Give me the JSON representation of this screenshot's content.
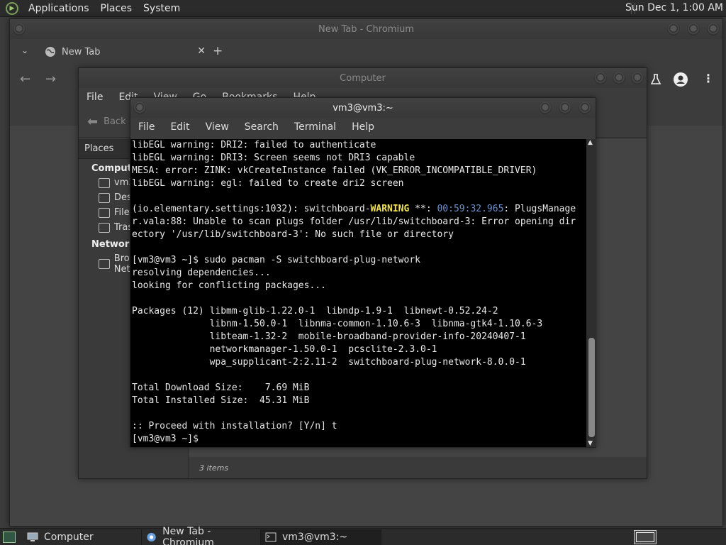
{
  "top_panel": {
    "menus": [
      "Applications",
      "Places",
      "System"
    ],
    "clock": "Sun Dec 1,  1:00 AM"
  },
  "chromium": {
    "title": "New Tab - Chromium",
    "tab_label": "New Tab"
  },
  "nautilus": {
    "title": "Computer",
    "menus": [
      "File",
      "Edit",
      "View",
      "Go",
      "Bookmarks",
      "Help"
    ],
    "toolbar_back": "Back",
    "sidebar": {
      "header": "Places",
      "sections": [
        {
          "title": "Computer",
          "items": [
            "vm3",
            "Desktop",
            "File System",
            "Trash"
          ]
        },
        {
          "title": "Network",
          "items": [
            "Browse Network"
          ]
        }
      ]
    },
    "status": "3 items"
  },
  "terminal": {
    "title": "vm3@vm3:~",
    "menus": [
      "File",
      "Edit",
      "View",
      "Search",
      "Terminal",
      "Help"
    ],
    "lines": [
      "libEGL warning: DRI2: failed to authenticate",
      "libEGL warning: DRI3: Screen seems not DRI3 capable",
      "MESA: error: ZINK: vkCreateInstance failed (VK_ERROR_INCOMPATIBLE_DRIVER)",
      "libEGL warning: egl: failed to create dri2 screen",
      "",
      "(io.elementary.settings:1032): switchboard-WARNING **: 00:59:32.965: PlugsManage",
      "r.vala:88: Unable to scan plugs folder /usr/lib/switchboard-3: Error opening dir",
      "ectory '/usr/lib/switchboard-3': No such file or directory",
      "",
      "[vm3@vm3 ~]$ sudo pacman -S switchboard-plug-network",
      "resolving dependencies...",
      "looking for conflicting packages...",
      "",
      "Packages (12) libmm-glib-1.22.0-1  libndp-1.9-1  libnewt-0.52.24-2",
      "              libnm-1.50.0-1  libnma-common-1.10.6-3  libnma-gtk4-1.10.6-3",
      "              libteam-1.32-2  mobile-broadband-provider-info-20240407-1",
      "              networkmanager-1.50.0-1  pcsclite-2.3.0-1",
      "              wpa_supplicant-2:2.11-2  switchboard-plug-network-8.0.0-1",
      "",
      "Total Download Size:    7.69 MiB",
      "Total Installed Size:  45.31 MiB",
      "",
      ":: Proceed with installation? [Y/n] t",
      "[vm3@vm3 ~]$"
    ],
    "warn_prefix": "(io.elementary.settings:1032): switchboard-",
    "warn_word": "WARNING",
    "warn_mid": " **: ",
    "warn_time": "00:59:32.965",
    "warn_rest": ": PlugsManage"
  },
  "taskbar": {
    "tasks": [
      "Computer",
      "New Tab - Chromium",
      "vm3@vm3:~"
    ]
  }
}
